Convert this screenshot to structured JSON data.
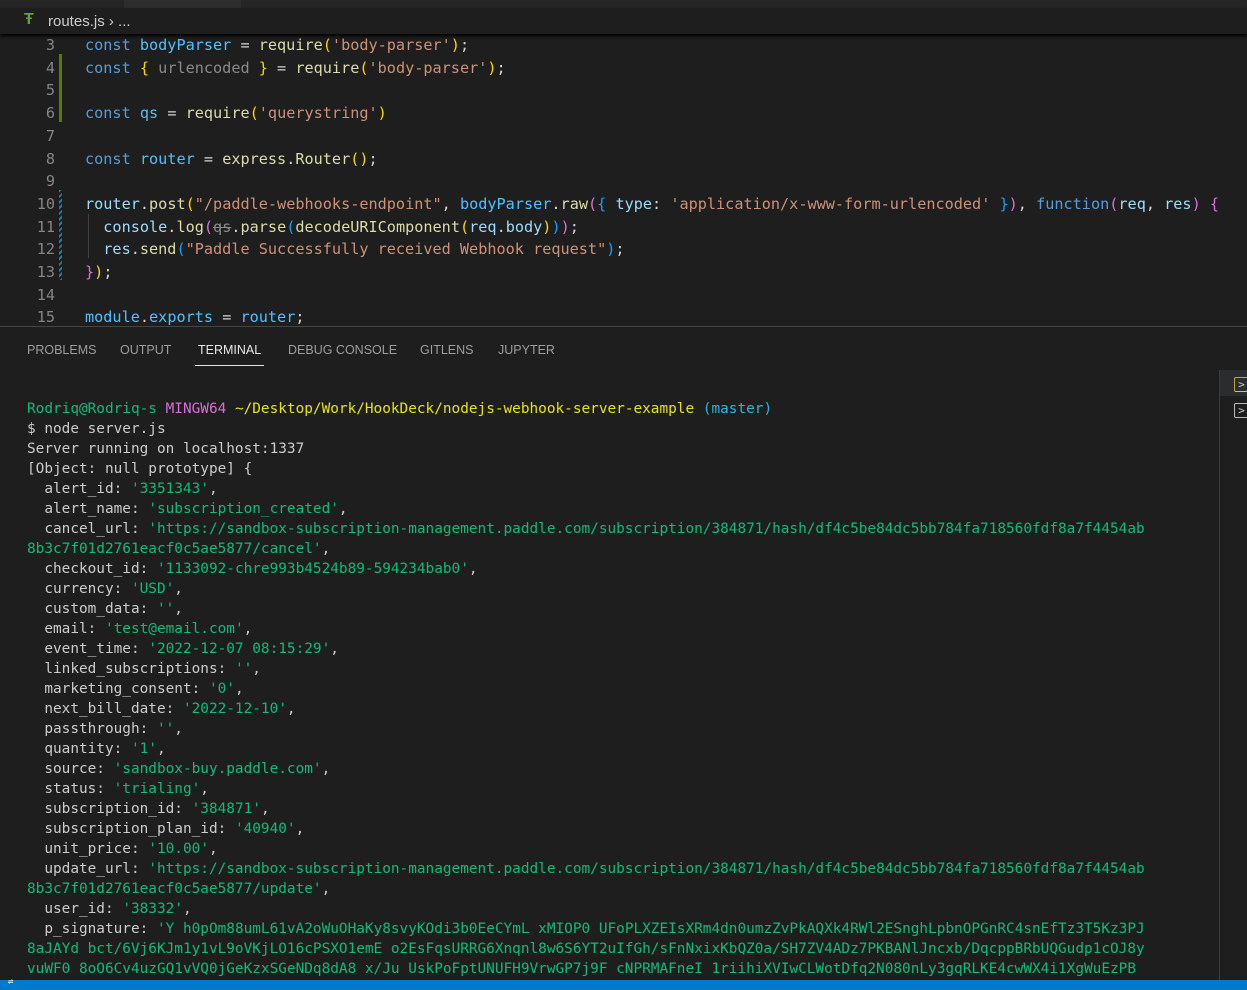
{
  "breadcrumb": {
    "file": "routes.js",
    "separator": "›",
    "rest": "...",
    "file_icon": "express-file-icon"
  },
  "colors": {
    "keyword": "#569cd6",
    "variable": "#4fc1ff",
    "function": "#dcdcaa",
    "string": "#ce9178",
    "plain": "#d4d4d4",
    "bracket1": "#ffd700",
    "bracket2": "#da70d6",
    "bracket3": "#179fff",
    "param": "#9cdcfe",
    "unused": "#8a8a8a",
    "term_green": "#0dbc79",
    "term_magenta": "#d670d6",
    "term_yellow": "#e5e510",
    "term_cyan": "#29b8db",
    "statusbar": "#007acc"
  },
  "editor": {
    "lines": [
      {
        "n": "3",
        "tokens": [
          [
            "const ",
            "keyword"
          ],
          [
            "bodyParser",
            "variable"
          ],
          [
            " = ",
            "plain"
          ],
          [
            "require",
            "function"
          ],
          [
            "(",
            "bracket1"
          ],
          [
            "'body-parser'",
            "string"
          ],
          [
            ")",
            "bracket1"
          ],
          [
            ";",
            "plain"
          ]
        ]
      },
      {
        "n": "4",
        "tokens": [
          [
            "const ",
            "keyword"
          ],
          [
            "{ ",
            "bracket1"
          ],
          [
            "urlencoded",
            "unused"
          ],
          [
            " }",
            "bracket1"
          ],
          [
            " = ",
            "plain"
          ],
          [
            "require",
            "function"
          ],
          [
            "(",
            "bracket1"
          ],
          [
            "'body-parser'",
            "string"
          ],
          [
            ")",
            "bracket1"
          ],
          [
            ";",
            "plain"
          ]
        ]
      },
      {
        "n": "5",
        "tokens": []
      },
      {
        "n": "6",
        "tokens": [
          [
            "const ",
            "keyword"
          ],
          [
            "qs",
            "variable"
          ],
          [
            " = ",
            "plain"
          ],
          [
            "require",
            "function"
          ],
          [
            "(",
            "bracket1"
          ],
          [
            "'querystring'",
            "string"
          ],
          [
            ")",
            "bracket1"
          ]
        ]
      },
      {
        "n": "7",
        "tokens": []
      },
      {
        "n": "8",
        "tokens": [
          [
            "const ",
            "keyword"
          ],
          [
            "router",
            "variable"
          ],
          [
            " = ",
            "plain"
          ],
          [
            "express",
            "function"
          ],
          [
            ".",
            "plain"
          ],
          [
            "Router",
            "function"
          ],
          [
            "()",
            "bracket1"
          ],
          [
            ";",
            "plain"
          ]
        ]
      },
      {
        "n": "9",
        "tokens": []
      },
      {
        "n": "10",
        "tokens": [
          [
            "router",
            "param"
          ],
          [
            ".",
            "plain"
          ],
          [
            "post",
            "function"
          ],
          [
            "(",
            "bracket1"
          ],
          [
            "\"/paddle-webhooks-endpoint\"",
            "string"
          ],
          [
            ", ",
            "plain"
          ],
          [
            "bodyParser",
            "variable"
          ],
          [
            ".",
            "plain"
          ],
          [
            "raw",
            "function"
          ],
          [
            "(",
            "bracket2"
          ],
          [
            "{ ",
            "bracket3"
          ],
          [
            "type",
            "param"
          ],
          [
            ": ",
            "plain"
          ],
          [
            "'application/x-www-form-urlencoded'",
            "string"
          ],
          [
            " }",
            "bracket3"
          ],
          [
            ")",
            "bracket2"
          ],
          [
            ", ",
            "plain"
          ],
          [
            "function",
            "keyword"
          ],
          [
            "(",
            "bracket2"
          ],
          [
            "req",
            "param"
          ],
          [
            ", ",
            "plain"
          ],
          [
            "res",
            "param"
          ],
          [
            ")",
            "bracket2"
          ],
          [
            " {",
            "bracket2"
          ]
        ]
      },
      {
        "n": "11",
        "tokens": [
          [
            "  console",
            "param"
          ],
          [
            ".",
            "plain"
          ],
          [
            "log",
            "function"
          ],
          [
            "(",
            "bracket2"
          ],
          [
            "qs",
            "strike"
          ],
          [
            ".",
            "plain"
          ],
          [
            "parse",
            "function"
          ],
          [
            "(",
            "bracket3"
          ],
          [
            "decodeURIComponent",
            "function"
          ],
          [
            "(",
            "bracket1"
          ],
          [
            "req",
            "param"
          ],
          [
            ".",
            "plain"
          ],
          [
            "body",
            "param"
          ],
          [
            ")",
            "bracket1"
          ],
          [
            ")",
            "bracket3"
          ],
          [
            ")",
            "bracket2"
          ],
          [
            ";",
            "plain"
          ]
        ]
      },
      {
        "n": "12",
        "tokens": [
          [
            "  res",
            "param"
          ],
          [
            ".",
            "plain"
          ],
          [
            "send",
            "function"
          ],
          [
            "(",
            "bracket3"
          ],
          [
            "\"Paddle Successfully received Webhook request\"",
            "string"
          ],
          [
            ")",
            "bracket3"
          ],
          [
            ";",
            "plain"
          ]
        ]
      },
      {
        "n": "13",
        "tokens": [
          [
            "}",
            "bracket2"
          ],
          [
            ")",
            "bracket1"
          ],
          [
            ";",
            "plain"
          ]
        ]
      },
      {
        "n": "14",
        "tokens": []
      },
      {
        "n": "15",
        "tokens": [
          [
            "module",
            "variable"
          ],
          [
            ".",
            "plain"
          ],
          [
            "exports",
            "variable"
          ],
          [
            " = ",
            "plain"
          ],
          [
            "router",
            "variable"
          ],
          [
            ";",
            "plain"
          ]
        ]
      }
    ]
  },
  "panel": {
    "tabs": [
      "PROBLEMS",
      "OUTPUT",
      "TERMINAL",
      "DEBUG CONSOLE",
      "GITLENS",
      "JUPYTER"
    ],
    "active": "TERMINAL"
  },
  "terminal": {
    "lines": [
      [
        [
          "Rodriq@Rodriq-s ",
          "green"
        ],
        [
          "MINGW64 ",
          "magenta"
        ],
        [
          "~/Desktop/Work/HookDeck/nodejs-webhook-server-example ",
          "yellow"
        ],
        [
          "(master)",
          "cyan"
        ]
      ],
      [
        [
          "$ node server.js",
          "plain"
        ]
      ],
      [
        [
          "Server running on localhost:1337",
          "plain"
        ]
      ],
      [
        [
          "[Object: null prototype] {",
          "plain"
        ]
      ],
      [
        [
          "  alert_id: ",
          "plain"
        ],
        [
          "'3351343'",
          "green"
        ],
        [
          ",",
          "plain"
        ]
      ],
      [
        [
          "  alert_name: ",
          "plain"
        ],
        [
          "'subscription_created'",
          "green"
        ],
        [
          ",",
          "plain"
        ]
      ],
      [
        [
          "  cancel_url: ",
          "plain"
        ],
        [
          "'https://sandbox-subscription-management.paddle.com/subscription/384871/hash/df4c5be84dc5bb784fa718560fdf8a7f4454ab",
          "green"
        ]
      ],
      [
        [
          "8b3c7f01d2761eacf0c5ae5877/cancel'",
          "green"
        ],
        [
          ",",
          "plain"
        ]
      ],
      [
        [
          "  checkout_id: ",
          "plain"
        ],
        [
          "'1133092-chre993b4524b89-594234bab0'",
          "green"
        ],
        [
          ",",
          "plain"
        ]
      ],
      [
        [
          "  currency: ",
          "plain"
        ],
        [
          "'USD'",
          "green"
        ],
        [
          ",",
          "plain"
        ]
      ],
      [
        [
          "  custom_data: ",
          "plain"
        ],
        [
          "''",
          "green"
        ],
        [
          ",",
          "plain"
        ]
      ],
      [
        [
          "  email: ",
          "plain"
        ],
        [
          "'test@email.com'",
          "green"
        ],
        [
          ",",
          "plain"
        ]
      ],
      [
        [
          "  event_time: ",
          "plain"
        ],
        [
          "'2022-12-07 08:15:29'",
          "green"
        ],
        [
          ",",
          "plain"
        ]
      ],
      [
        [
          "  linked_subscriptions: ",
          "plain"
        ],
        [
          "''",
          "green"
        ],
        [
          ",",
          "plain"
        ]
      ],
      [
        [
          "  marketing_consent: ",
          "plain"
        ],
        [
          "'0'",
          "green"
        ],
        [
          ",",
          "plain"
        ]
      ],
      [
        [
          "  next_bill_date: ",
          "plain"
        ],
        [
          "'2022-12-10'",
          "green"
        ],
        [
          ",",
          "plain"
        ]
      ],
      [
        [
          "  passthrough: ",
          "plain"
        ],
        [
          "''",
          "green"
        ],
        [
          ",",
          "plain"
        ]
      ],
      [
        [
          "  quantity: ",
          "plain"
        ],
        [
          "'1'",
          "green"
        ],
        [
          ",",
          "plain"
        ]
      ],
      [
        [
          "  source: ",
          "plain"
        ],
        [
          "'sandbox-buy.paddle.com'",
          "green"
        ],
        [
          ",",
          "plain"
        ]
      ],
      [
        [
          "  status: ",
          "plain"
        ],
        [
          "'trialing'",
          "green"
        ],
        [
          ",",
          "plain"
        ]
      ],
      [
        [
          "  subscription_id: ",
          "plain"
        ],
        [
          "'384871'",
          "green"
        ],
        [
          ",",
          "plain"
        ]
      ],
      [
        [
          "  subscription_plan_id: ",
          "plain"
        ],
        [
          "'40940'",
          "green"
        ],
        [
          ",",
          "plain"
        ]
      ],
      [
        [
          "  unit_price: ",
          "plain"
        ],
        [
          "'10.00'",
          "green"
        ],
        [
          ",",
          "plain"
        ]
      ],
      [
        [
          "  update_url: ",
          "plain"
        ],
        [
          "'https://sandbox-subscription-management.paddle.com/subscription/384871/hash/df4c5be84dc5bb784fa718560fdf8a7f4454ab",
          "green"
        ]
      ],
      [
        [
          "8b3c7f01d2761eacf0c5ae5877/update'",
          "green"
        ],
        [
          ",",
          "plain"
        ]
      ],
      [
        [
          "  user_id: ",
          "plain"
        ],
        [
          "'38332'",
          "green"
        ],
        [
          ",",
          "plain"
        ]
      ],
      [
        [
          "  p_signature: ",
          "plain"
        ],
        [
          "'Y h0pOm88umL61vA2oWuOHaKy8svyKOdi3b0EeCYmL xMIOP0 UFoPLXZEIsXRm4dn0umzZvPkAQXk4RWl2ESnghLpbnOPGnRC4snEfTz3T5Kz3PJ",
          "green"
        ]
      ],
      [
        [
          "8aJAYd bct/6Vj6KJm1y1vL9oVKjLO16cPSXO1emE o2EsFqsURRG6Xnqnl8w6S6YT2uIfGh/sFnNxixKbQZ0a/SH7ZV4ADz7PKBANlJncxb/DqcppBRbUQGudp1cOJ8y",
          "green"
        ]
      ],
      [
        [
          "vuWF0 8oO6Cv4uzGQ1vVQ0jGeKzxSGeNDq8dA8 x/Ju UskPoFptUNUFH9VrwGP7j9F cNPRMAFneI 1riihiXVIwCLWotDfq2N080nLy3gqRLKE4cwWX4i1XgWuEzPB",
          "green"
        ]
      ]
    ]
  }
}
